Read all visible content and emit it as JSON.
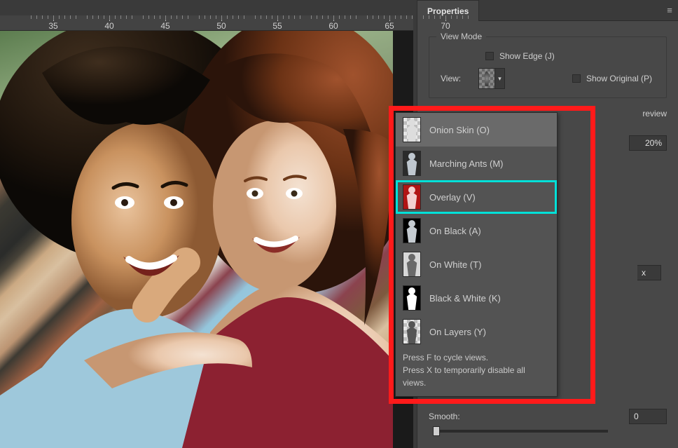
{
  "ruler": {
    "ticks": [
      "35",
      "40",
      "45",
      "50",
      "55",
      "60",
      "65",
      "70"
    ]
  },
  "panel": {
    "tab_label": "Properties",
    "view_mode_title": "View Mode",
    "view_label": "View:",
    "show_edge_label": "Show Edge (J)",
    "show_original_label": "Show Original (P)",
    "preview_clip": "review",
    "percent_value": "20%",
    "px_clip": "x",
    "smooth_label": "Smooth:",
    "smooth_value": "0"
  },
  "dropdown": {
    "items": [
      {
        "label": "Onion Skin (O)",
        "bg_type": "checker",
        "fg": "#dddddd",
        "active": true
      },
      {
        "label": "Marching Ants (M)",
        "bg": "#2b2b2b",
        "fg": "#bfc7cf"
      },
      {
        "label": "Overlay (V)",
        "bg": "#b01414",
        "fg": "#f2d0d0",
        "highlight": true
      },
      {
        "label": "On Black (A)",
        "bg": "#000000",
        "fg": "#c5cbd1"
      },
      {
        "label": "On White (T)",
        "bg": "#d8d8d8",
        "fg": "#6a6a6a"
      },
      {
        "label": "Black & White (K)",
        "bg": "#000000",
        "fg": "#ffffff"
      },
      {
        "label": "On Layers (Y)",
        "bg_type": "checker",
        "fg": "#555555"
      }
    ],
    "hint1": "Press F to cycle views.",
    "hint2": "Press X to temporarily disable all views."
  }
}
